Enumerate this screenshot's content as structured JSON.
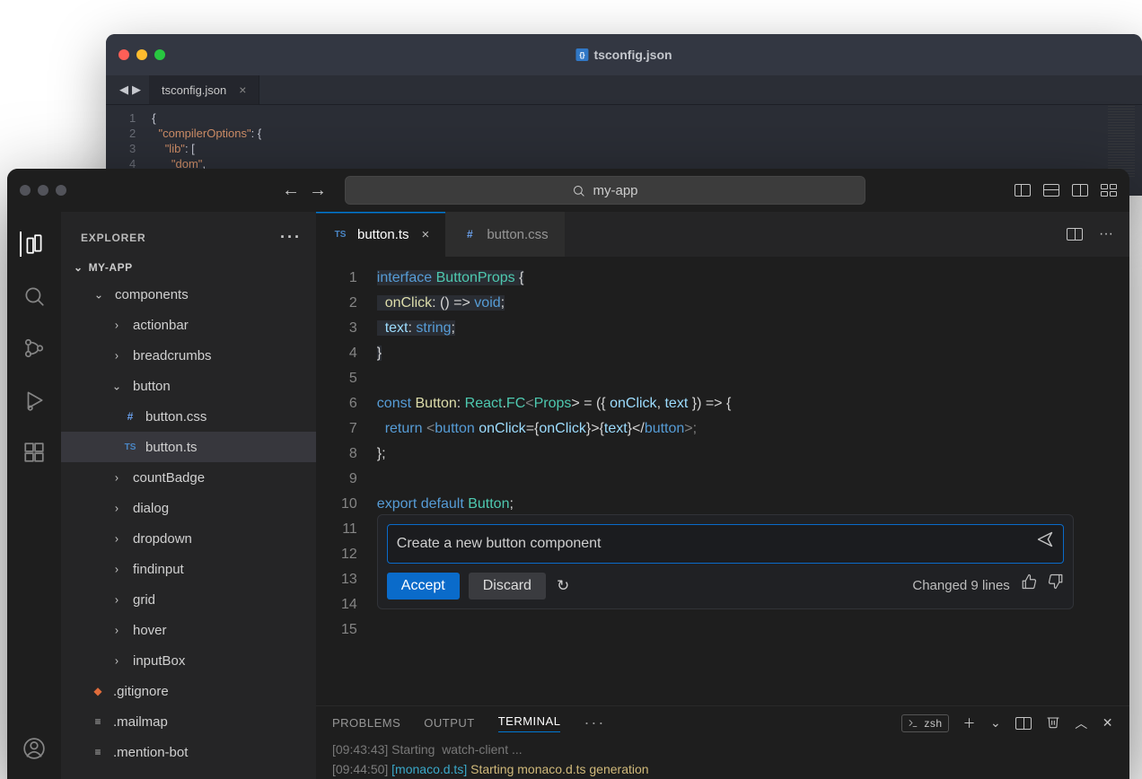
{
  "back_window": {
    "title_file": "tsconfig.json",
    "tab_label": "tsconfig.json",
    "lines": [
      "1",
      "2",
      "3",
      "4"
    ],
    "code": {
      "l1_open": "{",
      "l2_key": "\"compilerOptions\"",
      "l2_rest": ": {",
      "l3_key": "\"lib\"",
      "l3_rest": ": [",
      "l4_val": "\"dom\"",
      "l4_rest": ","
    }
  },
  "front_window": {
    "search_text": "my-app",
    "explorer_title": "EXPLORER",
    "root_folder": "MY-APP",
    "tree": [
      {
        "type": "folder",
        "depth": 1,
        "open": true,
        "label": "components"
      },
      {
        "type": "folder",
        "depth": 2,
        "open": false,
        "label": "actionbar"
      },
      {
        "type": "folder",
        "depth": 2,
        "open": false,
        "label": "breadcrumbs"
      },
      {
        "type": "folder",
        "depth": 2,
        "open": true,
        "label": "button"
      },
      {
        "type": "file",
        "depth": 3,
        "icon": "css",
        "label": "button.css"
      },
      {
        "type": "file",
        "depth": 3,
        "icon": "ts",
        "label": "button.ts",
        "selected": true
      },
      {
        "type": "folder",
        "depth": 2,
        "open": false,
        "label": "countBadge"
      },
      {
        "type": "folder",
        "depth": 2,
        "open": false,
        "label": "dialog"
      },
      {
        "type": "folder",
        "depth": 2,
        "open": false,
        "label": "dropdown"
      },
      {
        "type": "folder",
        "depth": 2,
        "open": false,
        "label": "findinput"
      },
      {
        "type": "folder",
        "depth": 2,
        "open": false,
        "label": "grid"
      },
      {
        "type": "folder",
        "depth": 2,
        "open": false,
        "label": "hover"
      },
      {
        "type": "folder",
        "depth": 2,
        "open": false,
        "label": "inputBox"
      },
      {
        "type": "file",
        "depth": 1,
        "icon": "git",
        "label": ".gitignore"
      },
      {
        "type": "file",
        "depth": 1,
        "icon": "txt",
        "label": ".mailmap"
      },
      {
        "type": "file",
        "depth": 1,
        "icon": "txt",
        "label": ".mention-bot"
      }
    ],
    "tabs": [
      {
        "icon": "ts",
        "label": "button.ts",
        "active": true,
        "closable": true
      },
      {
        "icon": "css",
        "label": "button.css",
        "active": false,
        "closable": false
      }
    ],
    "gutter": [
      "1",
      "2",
      "3",
      "4",
      "5",
      "6",
      "7",
      "8",
      "9",
      "10",
      "11",
      "12",
      "13",
      "14",
      "15"
    ],
    "code": {
      "l1_a": "interface",
      "l1_b": "ButtonProps",
      "l1_c": "{",
      "l2_a": "onClick",
      "l2_b": ": () =>",
      "l2_c": "void",
      "l2_d": ";",
      "l3_a": "text",
      "l3_b": ":",
      "l3_c": "string",
      "l3_d": ";",
      "l4": "}",
      "l6_a": "const",
      "l6_b": "Button",
      "l6_c": ":",
      "l6_d": "React",
      "l6_e": ".",
      "l6_f": "FC",
      "l6_g": "<",
      "l6_h": "Props",
      "l6_i": "> = ({",
      "l6_j": "onClick",
      "l6_k": ",",
      "l6_l": "text",
      "l6_m": "}) => {",
      "l7_a": "return",
      "l7_b": "<",
      "l7_c": "button",
      "l7_d": "onClick",
      "l7_e": "={",
      "l7_f": "onClick",
      "l7_g": "}>{",
      "l7_h": "text",
      "l7_i": "}</",
      "l7_j": "button",
      "l7_k": ">;",
      "l8": "};",
      "l10_a": "export",
      "l10_b": "default",
      "l10_c": "Button",
      "l10_d": ";"
    },
    "inline_chat": {
      "input_value": "Create a new button component",
      "accept": "Accept",
      "discard": "Discard",
      "status": "Changed 9 lines"
    },
    "panel": {
      "tabs": [
        "PROBLEMS",
        "OUTPUT",
        "TERMINAL"
      ],
      "active_tab": "TERMINAL",
      "shell": "zsh",
      "terminal_lines": [
        {
          "time": "[09:44:50]",
          "tag": "[monaco.d.ts]",
          "text": "Starting monaco.d.ts generation"
        }
      ]
    }
  }
}
